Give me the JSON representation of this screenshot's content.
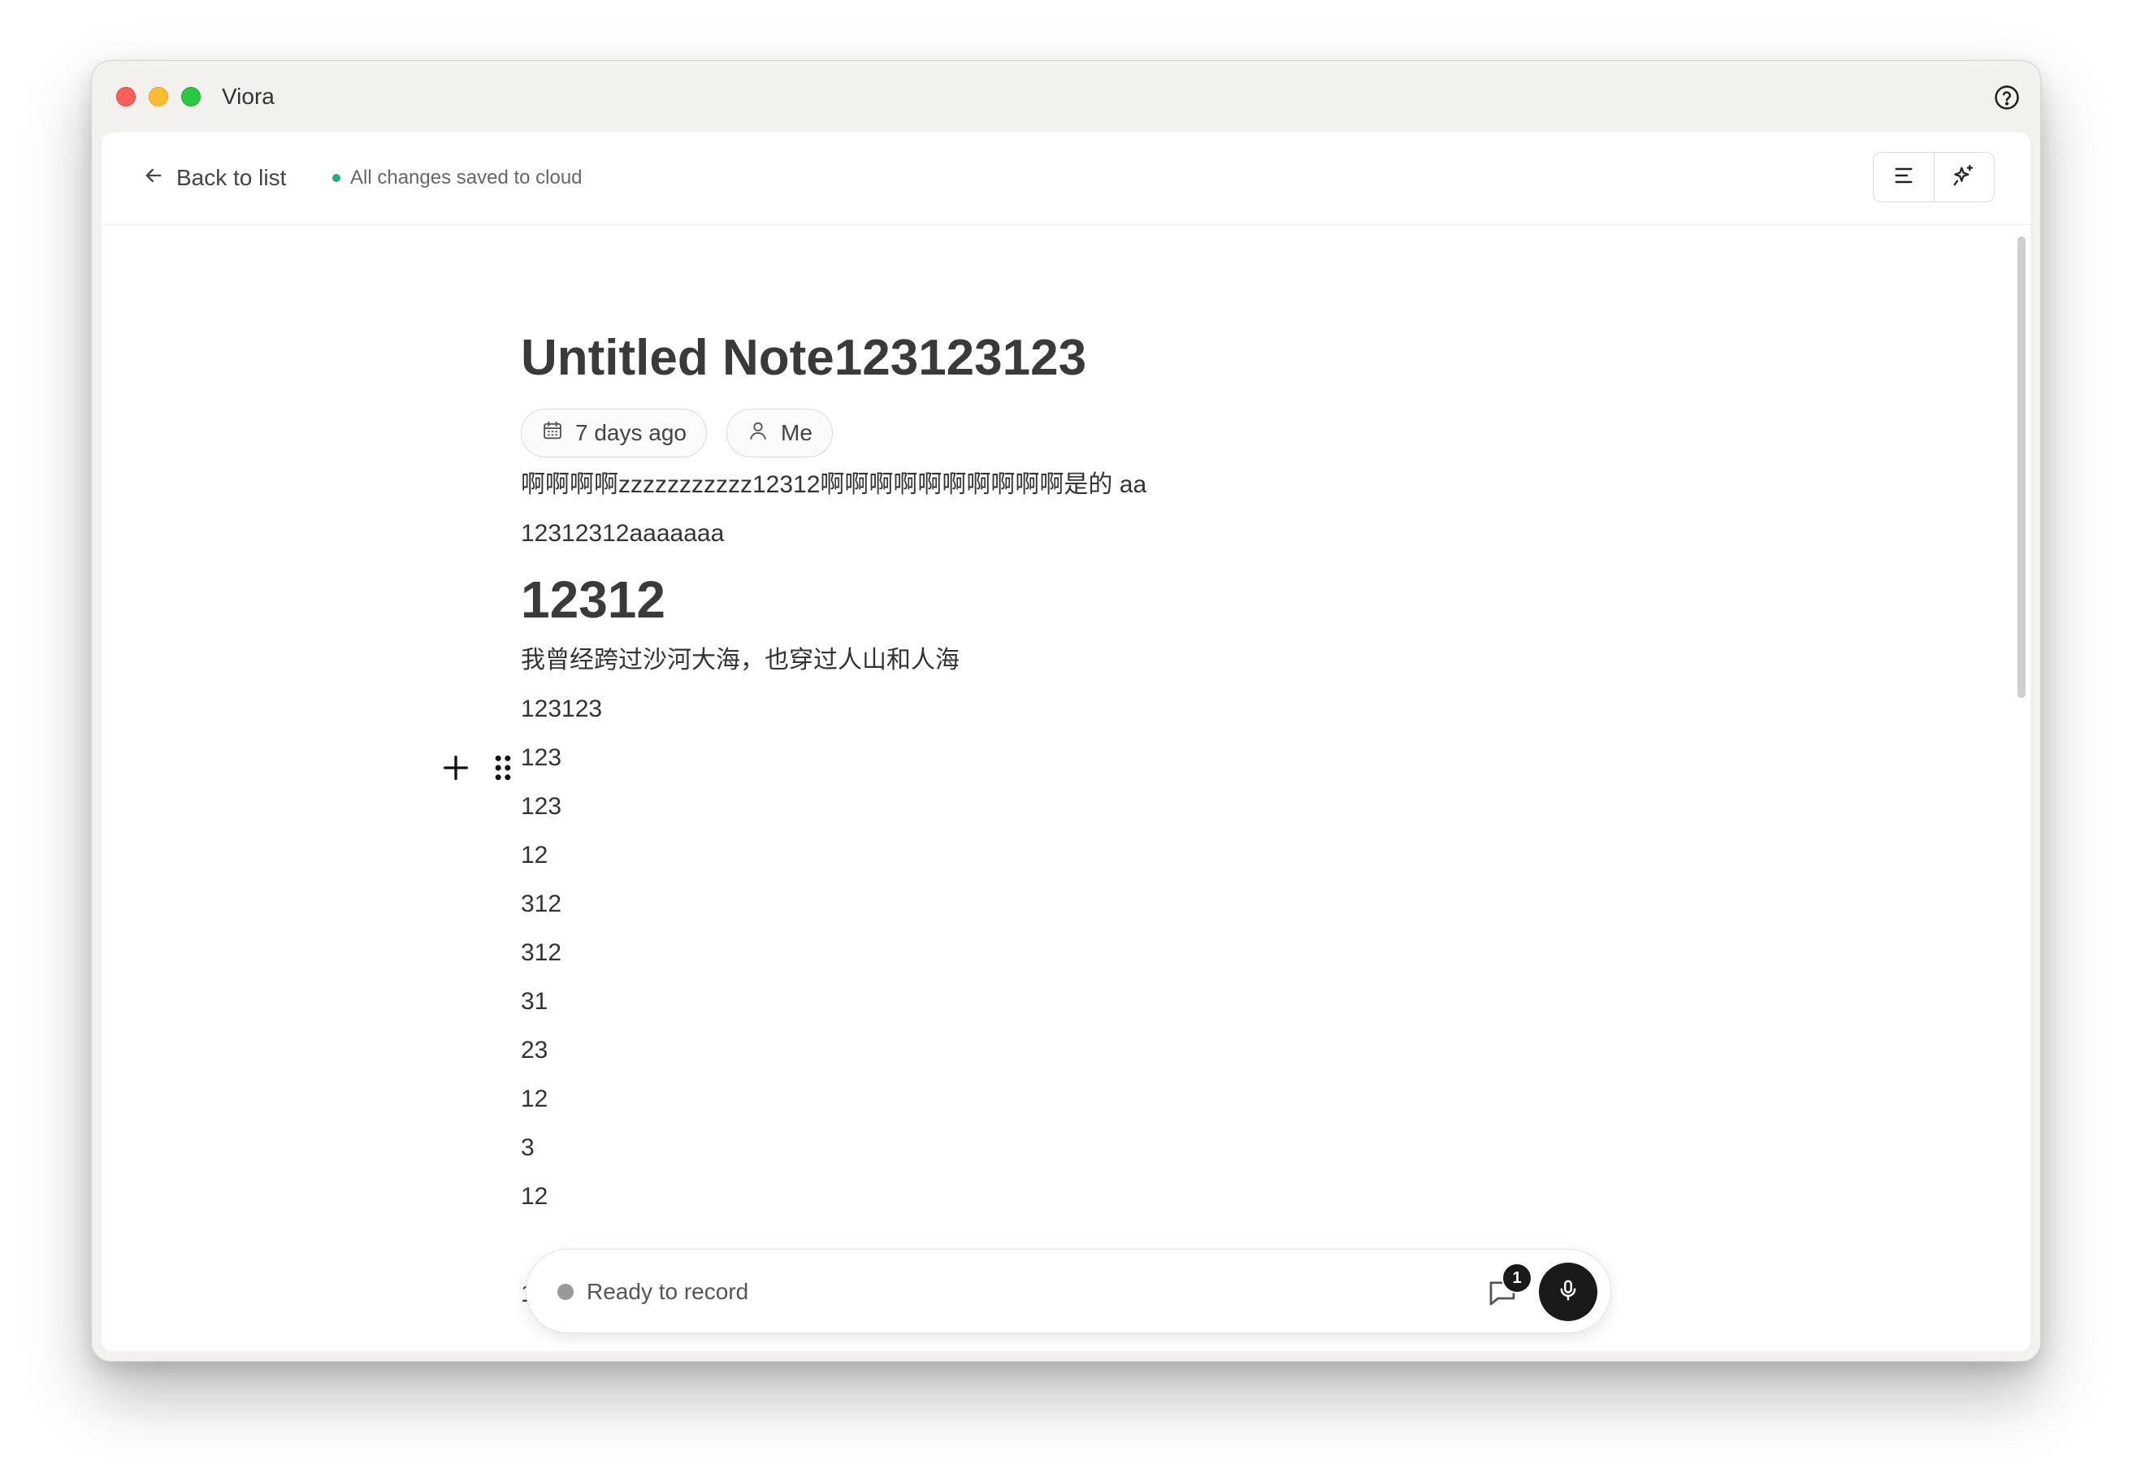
{
  "window": {
    "title": "Viora"
  },
  "topbar": {
    "back_label": "Back to list",
    "save_status": "All changes saved to cloud"
  },
  "note": {
    "title": "Untitled Note123123123",
    "date_chip": "7 days ago",
    "author_chip": "Me",
    "paragraph_1": "啊啊啊啊zzzzzzzzzzz12312啊啊啊啊啊啊啊啊啊啊是的 aa",
    "paragraph_2": "12312312aaaaaaa",
    "heading": "12312",
    "paragraph_3": "我曾经跨过沙河大海，也穿过人山和人海",
    "lines": [
      "123123",
      "123",
      "123",
      "12",
      "312",
      "312",
      "31",
      "23",
      "12",
      "3",
      "12",
      "",
      "123"
    ]
  },
  "recorder": {
    "status": "Ready to record",
    "comment_count": "1"
  },
  "icons": {
    "back": "arrow-left-icon",
    "calendar": "calendar-icon",
    "user": "user-icon",
    "outline": "outline-icon",
    "ai": "sparkles-icon",
    "help": "help-circle-icon",
    "add": "plus-icon",
    "drag": "drag-handle-icon",
    "comment": "comment-icon",
    "mic": "microphone-icon"
  },
  "colors": {
    "saved_dot": "#1fb37a",
    "mic_button": "#1a1a1a"
  }
}
